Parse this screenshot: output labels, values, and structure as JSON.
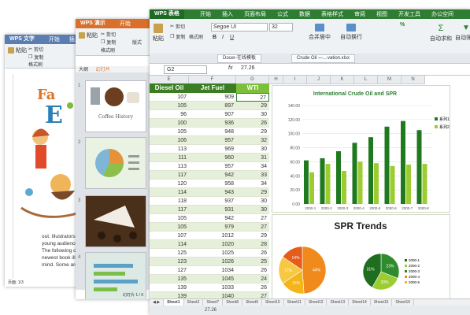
{
  "writer": {
    "app_button": "WPS 文字",
    "menu": [
      "开始",
      "插入"
    ],
    "tools": [
      "剪切",
      "复制",
      "格式刷",
      "粘贴"
    ],
    "doc_text": [
      "out. Illustrators o",
      "young audience.",
      "The following c",
      "newest book illu",
      "mind. Some are"
    ],
    "status": "页面: 1/3"
  },
  "presentation": {
    "app_button": "WPS 演示",
    "menu": [
      "开始",
      "插入"
    ],
    "tools": [
      "剪切",
      "复制",
      "格式刷",
      "粘贴",
      "版式"
    ],
    "panel_tabs": [
      "大纲",
      "幻灯片"
    ],
    "slides": [
      {
        "num": "1",
        "caption": "Coffee History"
      },
      {
        "num": "2",
        "caption": ""
      },
      {
        "num": "3",
        "caption": ""
      },
      {
        "num": "4",
        "caption": ""
      }
    ],
    "status": "幻灯片 1 / 6"
  },
  "spreadsheet": {
    "app_button": "WPS 表格",
    "menu": [
      "开始",
      "插入",
      "页面布局",
      "公式",
      "数据",
      "表格样式",
      "审阅",
      "视图",
      "开发工具",
      "办公空间"
    ],
    "tools": {
      "paste": "粘贴",
      "cut": "剪切",
      "copy": "复制",
      "format_painter": "格式刷",
      "font": "Segoe UI",
      "size": "32",
      "merge": "合并居中",
      "wrap": "自动换行",
      "autosum": "自动求和",
      "filter": "自动筛选",
      "percent": "%"
    },
    "doc_tabs": [
      "Docer-在线模板",
      "Crude Oil —…vation.xlsx"
    ],
    "name_box": "G2",
    "fx": "fx",
    "formula_value": "27.26",
    "col_letters": [
      "E",
      "F",
      "G",
      "H",
      "I",
      "J",
      "K",
      "L",
      "M",
      "N"
    ],
    "headers": [
      "Diesel Oil",
      "Jet Fuel",
      "WTI"
    ],
    "rows": [
      [
        "107",
        "909",
        "27"
      ],
      [
        "105",
        "897",
        "29"
      ],
      [
        "96",
        "907",
        "30"
      ],
      [
        "100",
        "936",
        "26"
      ],
      [
        "105",
        "948",
        "29"
      ],
      [
        "106",
        "957",
        "32"
      ],
      [
        "113",
        "969",
        "30"
      ],
      [
        "111",
        "960",
        "31"
      ],
      [
        "113",
        "957",
        "34"
      ],
      [
        "117",
        "942",
        "33"
      ],
      [
        "120",
        "958",
        "34"
      ],
      [
        "114",
        "943",
        "29"
      ],
      [
        "118",
        "937",
        "30"
      ],
      [
        "117",
        "931",
        "30"
      ],
      [
        "105",
        "942",
        "27"
      ],
      [
        "105",
        "979",
        "27"
      ],
      [
        "107",
        "1012",
        "29"
      ],
      [
        "114",
        "1020",
        "28"
      ],
      [
        "125",
        "1025",
        "26"
      ],
      [
        "123",
        "1026",
        "25"
      ],
      [
        "127",
        "1034",
        "26"
      ],
      [
        "135",
        "1045",
        "24"
      ],
      [
        "139",
        "1033",
        "26"
      ],
      [
        "139",
        "1040",
        "27"
      ]
    ],
    "sheet_tabs": [
      "Sheet1",
      "Sheet2",
      "Sheet7",
      "Sheet8",
      "Sheet9",
      "Sheet10",
      "Sheet11",
      "Sheet12",
      "Sheet13",
      "Sheet14",
      "Sheet15",
      "Sheet16"
    ],
    "status_value": "27.26"
  },
  "chart_data": [
    {
      "type": "bar",
      "title": "International Crude Oil and SPR",
      "categories": [
        "2000-1",
        "2000-2",
        "2000-3",
        "2000-4",
        "2000-5",
        "2000-6",
        "2000-7",
        "2000-8"
      ],
      "ylim": [
        0,
        140
      ],
      "yticks": [
        "140.00",
        "120.00",
        "100.00",
        "80.00",
        "60.00",
        "40.00",
        "20.00",
        "0.00"
      ],
      "legend": [
        "系列1",
        "系列2"
      ],
      "series": [
        {
          "name": "系列1",
          "values": [
            62,
            65,
            75,
            87,
            95,
            110,
            118,
            105
          ]
        },
        {
          "name": "系列2",
          "values": [
            45,
            57,
            47,
            60,
            58,
            54,
            56,
            57
          ]
        }
      ],
      "colors": [
        "#1f7a1f",
        "#9ccc2f"
      ]
    },
    {
      "type": "pie",
      "title": "SPR Trends",
      "pies": [
        {
          "labels": [
            "44%",
            "15%",
            "17%",
            "14%"
          ],
          "values": [
            44,
            15,
            17,
            14
          ],
          "colors": [
            "#f08a1c",
            "#f4b41a",
            "#f7c843",
            "#e65c1a"
          ]
        },
        {
          "labels": [
            "23%",
            "20%",
            "31%"
          ],
          "values": [
            23,
            20,
            31
          ],
          "colors": [
            "#2e8b2e",
            "#9ccc2f",
            "#1f6e1f"
          ]
        }
      ],
      "legend": [
        "2000-1",
        "2000-2",
        "2000-3",
        "2000-4",
        "2000-5"
      ]
    }
  ]
}
